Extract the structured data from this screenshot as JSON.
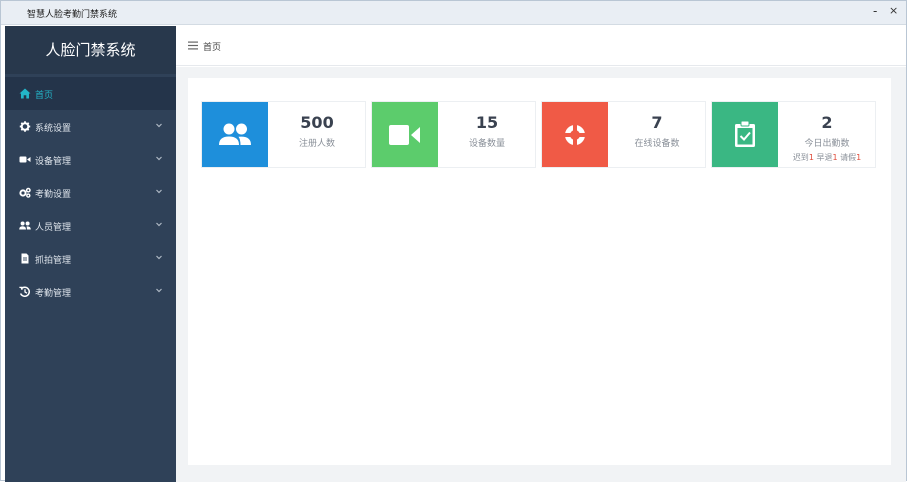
{
  "window": {
    "title": "智慧人脸考勤门禁系统",
    "minimize": "-",
    "close": "×"
  },
  "sidebar": {
    "brand": "人脸门禁系统",
    "items": [
      {
        "label": "首页",
        "icon": "home-icon"
      },
      {
        "label": "系统设置",
        "icon": "gear-icon"
      },
      {
        "label": "设备管理",
        "icon": "video-camera-icon"
      },
      {
        "label": "考勤设置",
        "icon": "gears-icon"
      },
      {
        "label": "人员管理",
        "icon": "users-icon"
      },
      {
        "label": "抓拍管理",
        "icon": "file-icon"
      },
      {
        "label": "考勤管理",
        "icon": "history-icon"
      }
    ]
  },
  "topbar": {
    "breadcrumb": "首页"
  },
  "colors": {
    "sidebar": "#2f4158",
    "active": "#23b5c8",
    "card_blue": "#1e8fdb",
    "card_green": "#5ccc6c",
    "card_red": "#f05a46",
    "card_teal": "#3ab783"
  },
  "cards": [
    {
      "value": "500",
      "label": "注册人数",
      "icon": "users-icon"
    },
    {
      "value": "15",
      "label": "设备数量",
      "icon": "video-camera-icon"
    },
    {
      "value": "7",
      "label": "在线设备数",
      "icon": "life-ring-icon"
    },
    {
      "value": "2",
      "label": "今日出勤数",
      "icon": "clipboard-check-icon",
      "late_label": "迟到",
      "late_count": "1",
      "early_label": "早退",
      "early_count": "1",
      "leave_label": "请假",
      "leave_count": "1"
    }
  ]
}
